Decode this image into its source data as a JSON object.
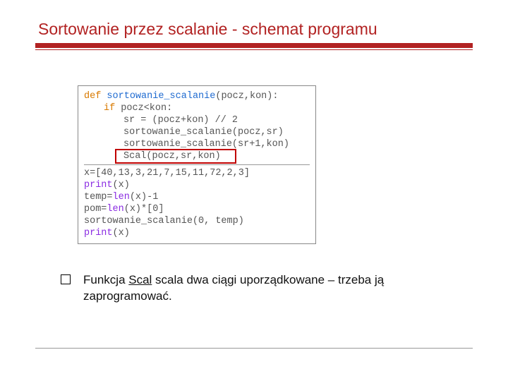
{
  "title": "Sortowanie przez scalanie - schemat programu",
  "code": {
    "def_kw": "def",
    "func_name": "sortowanie_scalanie",
    "func_params": "(pocz,kon):",
    "if_kw": "if",
    "if_cond": " pocz<kon:",
    "l1": "sr = (pocz+kon) // 2",
    "l2": "sortowanie_scalanie(pocz,sr)",
    "l3": "sortowanie_scalanie(sr+1,kon)",
    "l4": "Scal(pocz,sr,kon)",
    "b1": "x=[40,13,3,21,7,15,11,72,2,3]",
    "print_kw1": "print",
    "print_arg1": "(x)",
    "b2a": "temp=",
    "len_kw1": "len",
    "b2b": "(x)-1",
    "b3a": "pom=",
    "len_kw2": "len",
    "b3b": "(x)*[0]",
    "b4": "sortowanie_scalanie(0, temp)",
    "print_kw2": "print",
    "print_arg2": "(x)"
  },
  "bullet": {
    "pre": "Funkcja ",
    "scal": "Scal",
    "post": " scala dwa ciągi uporządkowane – trzeba ją zaprogramować."
  }
}
